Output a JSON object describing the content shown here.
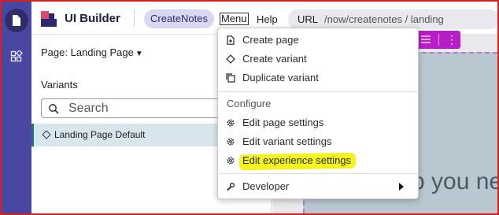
{
  "header": {
    "app_title": "UI Builder",
    "app_pill": "CreateNotes",
    "menu_label": "Menu",
    "help_label": "Help",
    "url_label": "URL",
    "url_value": "/now/createnotes / landing"
  },
  "sidebar_panel": {
    "page_label": "Page: Landing Page",
    "variants_heading": "Variants",
    "search_placeholder": "Search",
    "variants": [
      {
        "label": "Landing Page Default",
        "selected": true
      }
    ]
  },
  "menu": {
    "items": [
      {
        "label": "Create page",
        "icon": "new-page-icon"
      },
      {
        "label": "Create variant",
        "icon": "diamond-icon"
      },
      {
        "label": "Duplicate variant",
        "icon": "duplicate-icon"
      }
    ],
    "configure_heading": "Configure",
    "configure_items": [
      {
        "label": "Edit page settings",
        "icon": "gear-icon"
      },
      {
        "label": "Edit variant settings",
        "icon": "gear-icon"
      },
      {
        "label": "Edit experience settings",
        "icon": "gear-icon",
        "highlighted": true
      }
    ],
    "developer_label": "Developer"
  },
  "canvas": {
    "partial_text": "p you ne"
  },
  "colors": {
    "rail": "#4a47a3",
    "pill": "#d9d8f3",
    "toolbar": "#b81ec8",
    "highlight": "#f4f41c",
    "selected_row": "#d6e6ec"
  }
}
